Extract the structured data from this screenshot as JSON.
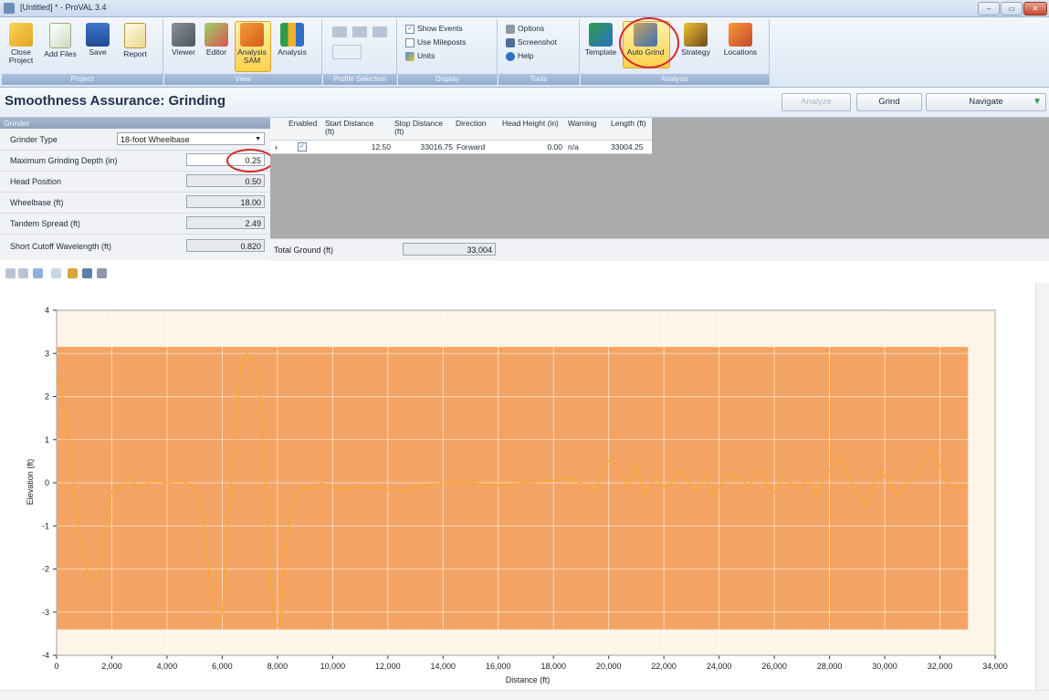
{
  "window": {
    "title": "[Untitled] * - ProVAL 3.4",
    "controls": [
      "–",
      "▭",
      "✕"
    ]
  },
  "ribbon": {
    "groups": {
      "project": "Project",
      "view": "View",
      "profile_selection": "Profile Selection",
      "display": "Display",
      "tools": "Tools",
      "analysis": "Analysis"
    },
    "project_buttons": [
      {
        "label": "Close Project",
        "icon": "folder-close-icon"
      },
      {
        "label": "Add Files",
        "icon": "add-files-icon"
      },
      {
        "label": "Save",
        "icon": "save-icon"
      },
      {
        "label": "Report",
        "icon": "report-icon"
      }
    ],
    "view_buttons": [
      {
        "label": "Viewer",
        "icon": "viewer-icon"
      },
      {
        "label": "Editor",
        "icon": "editor-icon"
      },
      {
        "label": "Analysis SAM",
        "icon": "analysis-sam-icon"
      },
      {
        "label": "Analysis",
        "icon": "analysis-icon"
      }
    ],
    "display_items": {
      "show_events": "Show Events",
      "use_mileposts": "Use Mileposts",
      "units": "Units"
    },
    "tools_items": {
      "options": "Options",
      "screenshot": "Screenshot",
      "help": "Help"
    },
    "analysis_buttons": [
      {
        "label": "Template",
        "icon": "template-icon"
      },
      {
        "label": "Auto Grind",
        "icon": "auto-grind-icon"
      },
      {
        "label": "Strategy",
        "icon": "strategy-icon"
      },
      {
        "label": "Locations",
        "icon": "locations-icon"
      }
    ]
  },
  "header": {
    "title": "Smoothness Assurance: Grinding",
    "buttons": {
      "analyze": "Analyze",
      "grind": "Grind",
      "navigate": "Navigate"
    }
  },
  "grinder_panel": {
    "title": "Grinder",
    "grinder_type_label": "Grinder Type",
    "grinder_type_value": "18-foot Wheelbase",
    "fields": [
      {
        "label": "Maximum Grinding Depth (in)",
        "value": "0.25"
      },
      {
        "label": "Head Position",
        "value": "0.50"
      },
      {
        "label": "Wheelbase (ft)",
        "value": "18.00"
      },
      {
        "label": "Tandem Spread (ft)",
        "value": "2.49"
      },
      {
        "label": "Short Cutoff Wavelength (ft)",
        "value": "0.820"
      }
    ]
  },
  "grid": {
    "headers": [
      "Enabled",
      "Start Distance (ft)",
      "Stop Distance (ft)",
      "Direction",
      "Head Height (in)",
      "Warning",
      "Length (ft)"
    ],
    "rows": [
      {
        "enabled": true,
        "start": "12.50",
        "stop": "33016.75",
        "direction": "Forward",
        "head_height": "0.00",
        "warning": "n/a",
        "length": "33004.25"
      }
    ],
    "total_label": "Total Ground (ft)",
    "total_value": "33,004"
  },
  "colors": {
    "fill": "#f3a465",
    "line": "#f9a825",
    "plot_bg": "#fdf5e6"
  },
  "chart_data": {
    "type": "line",
    "xlabel": "Distance (ft)",
    "ylabel": "Elevation (ft)",
    "xlim": [
      0,
      34000
    ],
    "ylim": [
      -4,
      4
    ],
    "x_ticks": [
      "0",
      "2,000",
      "4,000",
      "6,000",
      "8,000",
      "10,000",
      "12,000",
      "14,000",
      "16,000",
      "18,000",
      "20,000",
      "22,000",
      "24,000",
      "26,000",
      "28,000",
      "30,000",
      "32,000",
      "34,000"
    ],
    "y_ticks": [
      "4",
      "3",
      "2",
      "1",
      "0",
      "-1",
      "-2",
      "-3",
      "-4"
    ],
    "grind_band": {
      "x": [
        12.5,
        33016.75
      ],
      "y": [
        -3.4,
        3.15
      ]
    },
    "profile": {
      "x": [
        0,
        150,
        300,
        500,
        700,
        900,
        1100,
        1300,
        1500,
        1700,
        2000,
        2300,
        2600,
        3000,
        3500,
        4000,
        4500,
        5000,
        5300,
        5500,
        5700,
        5850,
        6000,
        6200,
        6500,
        6700,
        6900,
        7100,
        7300,
        7500,
        7700,
        7900,
        8100,
        8300,
        8500,
        8700,
        9000,
        9300,
        9600,
        10000,
        10500,
        11000,
        11500,
        12000,
        12500,
        13000,
        14000,
        15000,
        16000,
        17000,
        18000,
        18500,
        19000,
        19500,
        19800,
        20100,
        20400,
        20700,
        21000,
        21300,
        21700,
        22000,
        22300,
        22600,
        22900,
        23200,
        23500,
        23800,
        24100,
        24400,
        24800,
        25100,
        25400,
        25700,
        26000,
        26300,
        26600,
        26900,
        27200,
        27500,
        27800,
        28100,
        28400,
        28700,
        29000,
        29300,
        29600,
        29900,
        30200,
        30500,
        30800,
        31100,
        31400,
        31700,
        32000,
        32300,
        32600,
        33016
      ],
      "y": [
        2.5,
        2.3,
        1.6,
        0.8,
        -0.5,
        -1.5,
        -2.0,
        -2.3,
        -2.2,
        -1.2,
        -0.2,
        -0.15,
        0.1,
        -0.1,
        0.05,
        0.0,
        0.05,
        -0.1,
        -0.8,
        -2.0,
        -3.0,
        -3.3,
        -3.0,
        -1.0,
        1.5,
        2.8,
        3.0,
        2.9,
        2.6,
        1.0,
        -2.0,
        -3.3,
        -3.3,
        -1.6,
        -0.6,
        -0.2,
        -0.15,
        -0.1,
        0.0,
        -0.1,
        -0.15,
        -0.1,
        -0.1,
        -0.15,
        -0.2,
        -0.1,
        0.0,
        0.0,
        -0.05,
        0.0,
        0.05,
        0.1,
        0.0,
        -0.2,
        0.3,
        0.6,
        0.2,
        -0.1,
        0.4,
        -0.3,
        0.2,
        -0.1,
        0.0,
        0.3,
        0.0,
        -0.2,
        0.2,
        -0.3,
        0.0,
        0.2,
        0.1,
        -0.1,
        0.3,
        0.0,
        -0.2,
        0.1,
        0.0,
        -0.1,
        0.1,
        -0.3,
        0.1,
        0.4,
        0.6,
        0.1,
        -0.2,
        -0.6,
        0.0,
        0.3,
        -0.1,
        -0.3,
        0.0,
        0.2,
        0.5,
        0.8,
        0.4,
        0.0,
        -0.1,
        -0.1
      ]
    }
  }
}
